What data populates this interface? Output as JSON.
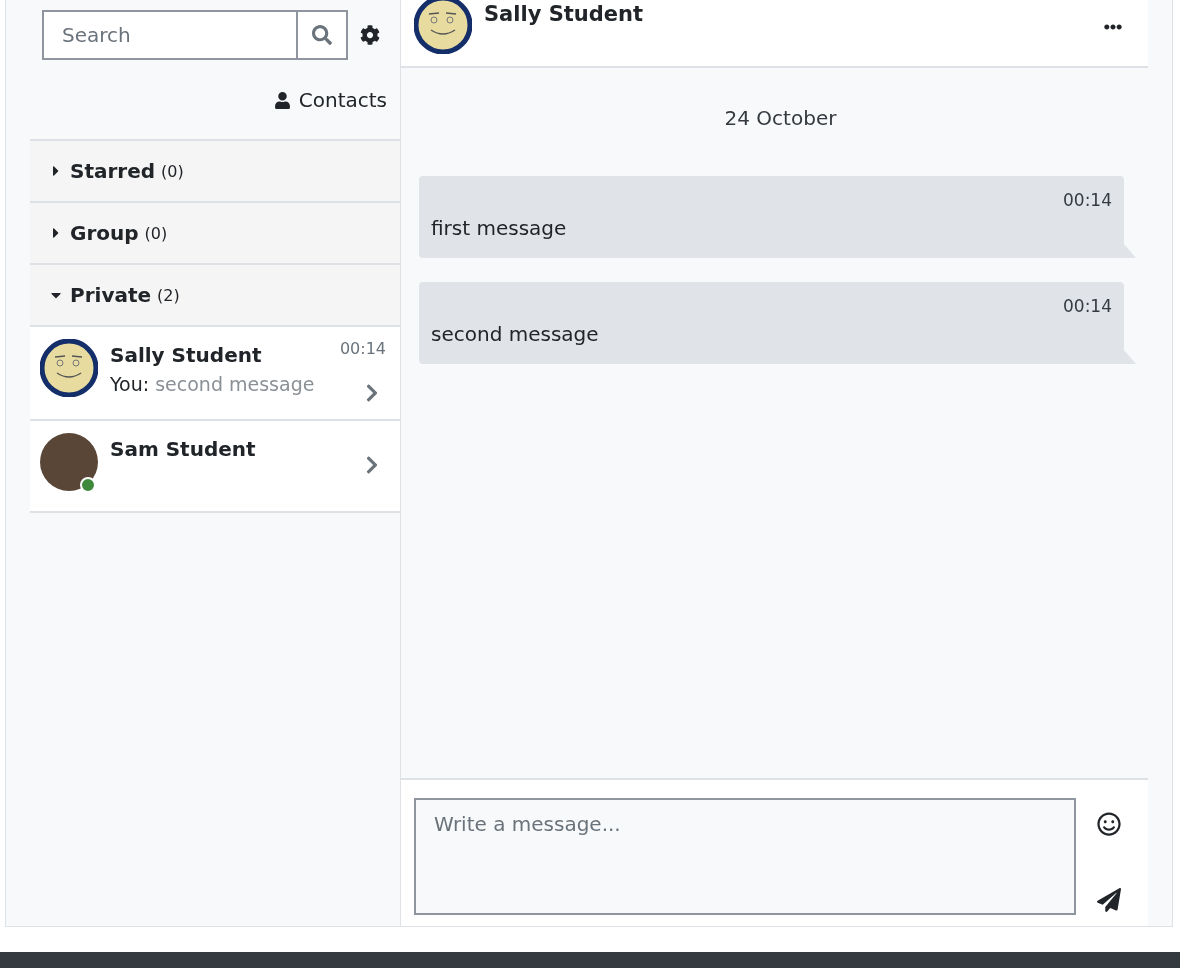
{
  "sidebar": {
    "search": {
      "placeholder": "Search"
    },
    "contacts_link": "Contacts",
    "sections": [
      {
        "title": "Starred",
        "count": "(0)",
        "expanded": false
      },
      {
        "title": "Group",
        "count": "(0)",
        "expanded": false
      },
      {
        "title": "Private",
        "count": "(2)",
        "expanded": true,
        "conversations": [
          {
            "name": "Sally Student",
            "time": "00:14",
            "preview_prefix": "You:",
            "preview": "second message",
            "kind": "cartoon",
            "online": false
          },
          {
            "name": "Sam Student",
            "kind": "photo",
            "online": true
          }
        ]
      }
    ]
  },
  "conversation": {
    "name": "Sally Student",
    "date": "24 October",
    "messages": [
      {
        "time": "00:14",
        "text": "first message"
      },
      {
        "time": "00:14",
        "text": "second message"
      }
    ],
    "composer": {
      "placeholder": "Write a message..."
    }
  }
}
